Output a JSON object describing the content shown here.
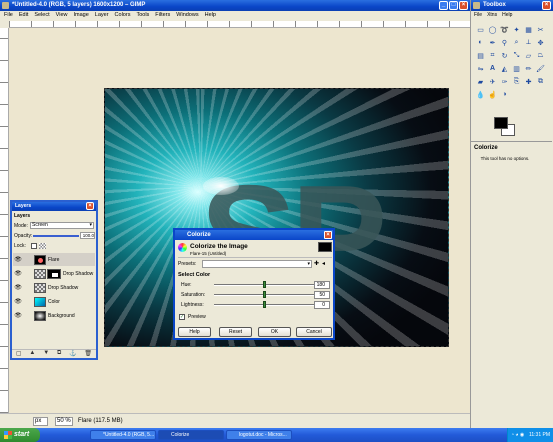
{
  "main_window": {
    "title": "*Untitled-4.0 (RGB, 5 layers) 1600x1200 – GIMP",
    "menu": [
      "File",
      "Edit",
      "Select",
      "View",
      "Image",
      "Layer",
      "Colors",
      "Tools",
      "Filters",
      "Windows",
      "Help"
    ]
  },
  "status": {
    "unit": "px",
    "zoom": "50 %",
    "text": "Flare (117.5 MB)"
  },
  "toolbox": {
    "title": "Toolbox",
    "menu": [
      "File",
      "Xtns",
      "Help"
    ],
    "tools": [
      "rect-select",
      "ellipse-select",
      "free-select",
      "fuzzy-select",
      "color-select",
      "scissors",
      "foreground-select",
      "paths",
      "color-picker",
      "zoom",
      "measure",
      "move",
      "align",
      "crop",
      "rotate",
      "scale",
      "shear",
      "perspective",
      "flip",
      "text",
      "bucket-fill",
      "blend",
      "pencil",
      "paintbrush",
      "eraser",
      "airbrush",
      "ink",
      "clone",
      "heal",
      "perspective-clone",
      "blur",
      "smudge",
      "dodge-burn"
    ],
    "fg_color": "#000000",
    "bg_color": "#ffffff",
    "options_title": "Colorize",
    "options_note": "This tool has no options."
  },
  "layers": {
    "title": "Layers",
    "mode_label": "Mode:",
    "mode_value": "Screen",
    "opacity_label": "Opacity:",
    "opacity_value": "100.0",
    "lock_label": "Lock:",
    "items": [
      {
        "name": "Flare"
      },
      {
        "name": "Drop Shadow"
      },
      {
        "name": "Drop Shadow"
      },
      {
        "name": "Color"
      },
      {
        "name": "Background"
      }
    ]
  },
  "colorize": {
    "title": "Colorize",
    "heading": "Colorize the Image",
    "subheading": "Flare-15 (Untitled)",
    "presets_label": "Presets:",
    "section": "Select Color",
    "hue_label": "Hue:",
    "hue_value": "180",
    "hue": 180,
    "saturation_label": "Saturation:",
    "saturation_value": "50",
    "saturation": 50,
    "lightness_label": "Lightness:",
    "lightness_value": "0",
    "lightness": 0,
    "preview_label": "Preview",
    "buttons": {
      "help": "Help",
      "reset": "Reset",
      "ok": "OK",
      "cancel": "Cancel"
    }
  },
  "taskbar": {
    "start": "start",
    "tasks": [
      "*Untitled-4.0 (RGB, 5...",
      "Colorize",
      "logotut.doc - Micros..."
    ],
    "clock": "11:31 PM"
  }
}
